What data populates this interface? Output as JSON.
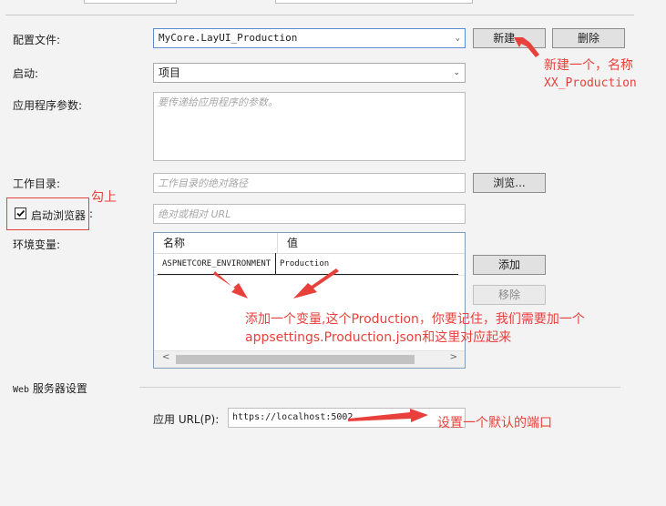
{
  "profile": {
    "label": "配置文件:",
    "value": "MyCore.LayUI_Production",
    "new_button": "新建...",
    "delete_button": "删除"
  },
  "launch": {
    "label": "启动:",
    "value": "项目"
  },
  "app_args": {
    "label": "应用程序参数:",
    "placeholder": "要传递给应用程序的参数。"
  },
  "working_dir": {
    "label": "工作目录:",
    "placeholder": "工作目录的绝对路径",
    "browse_button": "浏览..."
  },
  "launch_browser": {
    "label": "启动浏览器",
    "colon": ":",
    "checked": true,
    "url_placeholder": "绝对或相对 URL"
  },
  "env_vars": {
    "label": "环境变量:",
    "columns": [
      "名称",
      "值"
    ],
    "rows": [
      {
        "name": "ASPNETCORE_ENVIRONMENT",
        "value": "Production"
      }
    ],
    "add_button": "添加",
    "remove_button": "移除"
  },
  "web_server": {
    "section_title_web": "Web",
    "section_title_rest": "服务器设置",
    "app_url_label": "应用 URL(P):",
    "app_url_value": "https://localhost:5002"
  },
  "annotations": {
    "new_line1": "新建一个，名称",
    "new_line2": "XX_Production",
    "check": "勾上",
    "env_line1": "添加一个变量,这个Production，你要记住，我们需要加一个",
    "env_line2": "appsettings.Production.json和这里对应起来",
    "port": "设置一个默认的端口"
  },
  "colors": {
    "annotation": "#e8413c",
    "accent_blue": "#1e5aa8"
  }
}
